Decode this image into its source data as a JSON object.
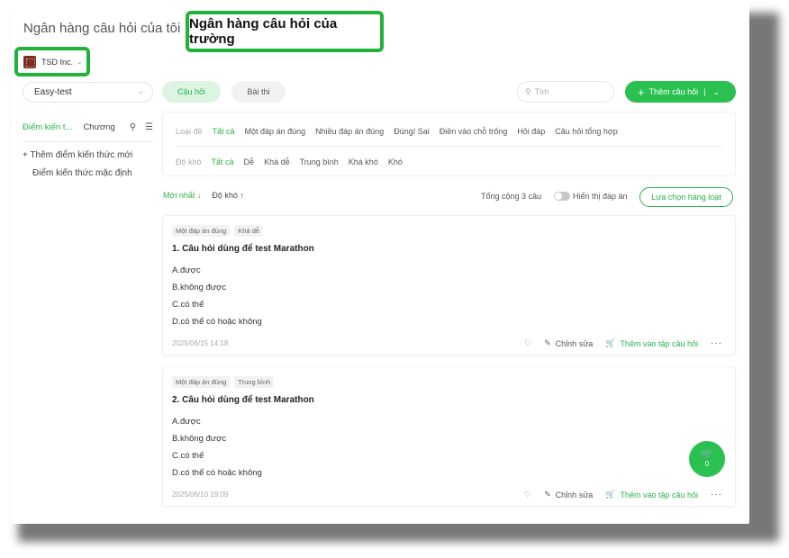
{
  "header": {
    "tab_school_inactive": "Ngân hàng câu hỏi của tôi",
    "tab_school_active": "Ngân hàng câu hỏi của trường",
    "org_name": "TSD Inc."
  },
  "left_panel": {
    "subject": "Easy-test",
    "tab_knowledge": "Điểm kiến t...",
    "tab_chapter": "Chương",
    "add_knowledge": "+ Thêm điểm kiến thức mới",
    "default_knowledge": "Điểm kiến thức mặc định"
  },
  "toolbar": {
    "seg_questions": "Câu hỏi",
    "seg_exams": "Bài thi",
    "search_placeholder": "Tìm",
    "add_question": "Thêm câu hỏi"
  },
  "filters": {
    "type_label": "Loại đề",
    "type_options": [
      "Tất cả",
      "Một đáp án đúng",
      "Nhiều đáp án đúng",
      "Đúng/ Sai",
      "Điền vào chỗ trống",
      "Hỏi đáp",
      "Câu hỏi tổng hợp"
    ],
    "difficulty_label": "Độ khó",
    "difficulty_options": [
      "Tất cả",
      "Dễ",
      "Khá dễ",
      "Trung bình",
      "Khá khó",
      "Khó"
    ]
  },
  "list_header": {
    "sort_newest": "Mới nhất ↓",
    "sort_difficulty": "Độ khó ↑",
    "total": "Tổng cộng 3 câu",
    "show_answers": "Hiển thị đáp án",
    "bulk_select": "Lựa chọn hàng loạt"
  },
  "questions": [
    {
      "tags": [
        "Một đáp án đúng",
        "Khá dễ"
      ],
      "title": "1. Câu hỏi dùng để test Marathon",
      "options": [
        "A.được",
        "B.không được",
        "C.có thể",
        "D.có thể có hoặc không"
      ],
      "date": "2025/06/15 14:18"
    },
    {
      "tags": [
        "Một đáp án đúng",
        "Trung bình"
      ],
      "title": "2. Câu hỏi dùng để test Marathon",
      "options": [
        "A.được",
        "B.không được",
        "C.có thể",
        "D.có thể có hoặc không"
      ],
      "date": "2025/06/10 19:09"
    }
  ],
  "actions": {
    "edit": "Chỉnh sửa",
    "add_to_set": "Thêm vào tập câu hỏi",
    "more": "···"
  },
  "cart": {
    "count": "0"
  },
  "colors": {
    "accent": "#2bc150",
    "highlight_border": "#1fb33a"
  }
}
